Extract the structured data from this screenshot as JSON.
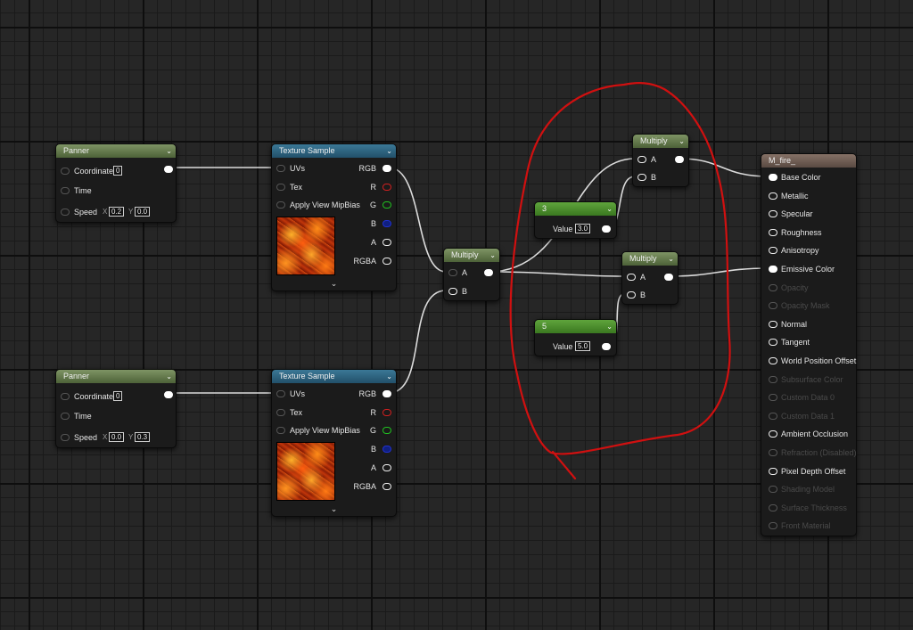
{
  "app": {
    "accent_color": "#d01010"
  },
  "panner1": {
    "title": "Panner",
    "coordinate_label": "Coordinate",
    "coordinate_value": "0",
    "time_label": "Time",
    "speed_label": "Speed",
    "x_label": "X",
    "x_value": "0.2",
    "y_label": "Y",
    "y_value": "0.0"
  },
  "panner2": {
    "title": "Panner",
    "coordinate_label": "Coordinate",
    "coordinate_value": "0",
    "time_label": "Time",
    "speed_label": "Speed",
    "x_label": "X",
    "x_value": "0.0",
    "y_label": "Y",
    "y_value": "0.3"
  },
  "texture1": {
    "title": "Texture Sample",
    "uvs_label": "UVs",
    "tex_label": "Tex",
    "mip_label": "Apply View MipBias",
    "rgb": "RGB",
    "r": "R",
    "g": "G",
    "b": "B",
    "a": "A",
    "rgba": "RGBA",
    "expand_icon": "chevron-down-icon"
  },
  "texture2": {
    "title": "Texture Sample",
    "uvs_label": "UVs",
    "tex_label": "Tex",
    "mip_label": "Apply View MipBias",
    "rgb": "RGB",
    "r": "R",
    "g": "G",
    "b": "B",
    "a": "A",
    "rgba": "RGBA",
    "expand_icon": "chevron-down-icon"
  },
  "multiply_center": {
    "title": "Multiply",
    "a_label": "A",
    "b_label": "B"
  },
  "multiply_top": {
    "title": "Multiply",
    "a_label": "A",
    "b_label": "B"
  },
  "multiply_bottom": {
    "title": "Multiply",
    "a_label": "A",
    "b_label": "B"
  },
  "constant3": {
    "title": "3",
    "value_label": "Value",
    "value": "3.0"
  },
  "constant5": {
    "title": "5",
    "value_label": "Value",
    "value": "5.0"
  },
  "material": {
    "title": "M_fire_",
    "inputs": [
      {
        "label": "Base Color",
        "enabled": true,
        "connected": true
      },
      {
        "label": "Metallic",
        "enabled": true,
        "connected": false
      },
      {
        "label": "Specular",
        "enabled": true,
        "connected": false
      },
      {
        "label": "Roughness",
        "enabled": true,
        "connected": false
      },
      {
        "label": "Anisotropy",
        "enabled": true,
        "connected": false
      },
      {
        "label": "Emissive Color",
        "enabled": true,
        "connected": true
      },
      {
        "label": "Opacity",
        "enabled": false,
        "connected": false
      },
      {
        "label": "Opacity Mask",
        "enabled": false,
        "connected": false
      },
      {
        "label": "Normal",
        "enabled": true,
        "connected": false
      },
      {
        "label": "Tangent",
        "enabled": true,
        "connected": false
      },
      {
        "label": "World Position Offset",
        "enabled": true,
        "connected": false
      },
      {
        "label": "Subsurface Color",
        "enabled": false,
        "connected": false
      },
      {
        "label": "Custom Data 0",
        "enabled": false,
        "connected": false
      },
      {
        "label": "Custom Data 1",
        "enabled": false,
        "connected": false
      },
      {
        "label": "Ambient Occlusion",
        "enabled": true,
        "connected": false
      },
      {
        "label": "Refraction (Disabled)",
        "enabled": false,
        "connected": false
      },
      {
        "label": "Pixel Depth Offset",
        "enabled": true,
        "connected": false
      },
      {
        "label": "Shading Model",
        "enabled": false,
        "connected": false
      },
      {
        "label": "Surface Thickness",
        "enabled": false,
        "connected": false
      },
      {
        "label": "Front Material",
        "enabled": false,
        "connected": false
      }
    ]
  }
}
